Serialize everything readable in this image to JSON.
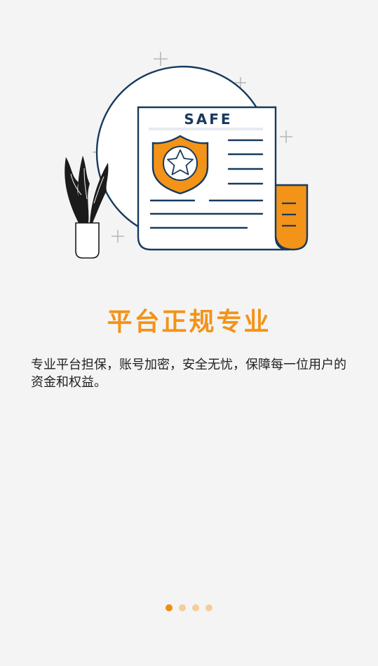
{
  "illustration": {
    "document_heading": "SAFE"
  },
  "title": "平台正规专业",
  "description": "专业平台担保，账号加密，安全无忧，保障每一位用户的资金和权益。",
  "pager": {
    "total": 4,
    "active_index": 0
  },
  "colors": {
    "accent": "#f39318",
    "navy": "#173a5e",
    "background": "#f4f4f4"
  }
}
